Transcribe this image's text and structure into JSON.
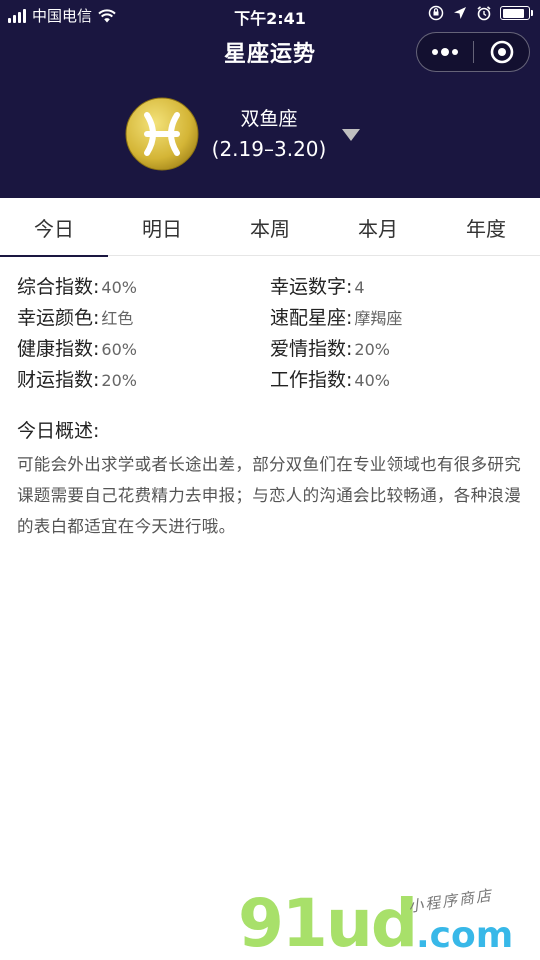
{
  "status_bar": {
    "carrier": "中国电信",
    "time": "下午2:41",
    "battery_level": 0.85
  },
  "nav": {
    "title": "星座运势",
    "more_icon": "more-dots-icon",
    "close_icon": "circle-close-icon"
  },
  "sign": {
    "symbol": "♓",
    "name": "双鱼座",
    "range": "(2.19–3.20)",
    "badge_color": "#d9b83a"
  },
  "tabs": [
    {
      "label": "今日",
      "active": true
    },
    {
      "label": "明日",
      "active": false
    },
    {
      "label": "本周",
      "active": false
    },
    {
      "label": "本月",
      "active": false
    },
    {
      "label": "年度",
      "active": false
    }
  ],
  "stats": [
    {
      "label": "综合指数:",
      "value": "40%"
    },
    {
      "label": "幸运数字:",
      "value": "4"
    },
    {
      "label": "幸运颜色:",
      "value": "红色"
    },
    {
      "label": "速配星座:",
      "value": "摩羯座"
    },
    {
      "label": "健康指数:",
      "value": "60%"
    },
    {
      "label": "爱情指数:",
      "value": "20%"
    },
    {
      "label": "财运指数:",
      "value": "20%"
    },
    {
      "label": "工作指数:",
      "value": "40%"
    }
  ],
  "overview": {
    "title": "今日概述:",
    "text": "可能会外出求学或者长途出差，部分双鱼们在专业领域也有很多研究课题需要自己花费精力去申报；与恋人的沟通会比较畅通，各种浪漫的表白都适宜在今天进行哦。"
  },
  "watermark": {
    "main": "91ud",
    "domain": ".com",
    "sub": "小程序商店"
  },
  "colors": {
    "header_bg": "#1a1640",
    "watermark_green": "#a8e06a",
    "watermark_blue": "#38b8e8"
  }
}
